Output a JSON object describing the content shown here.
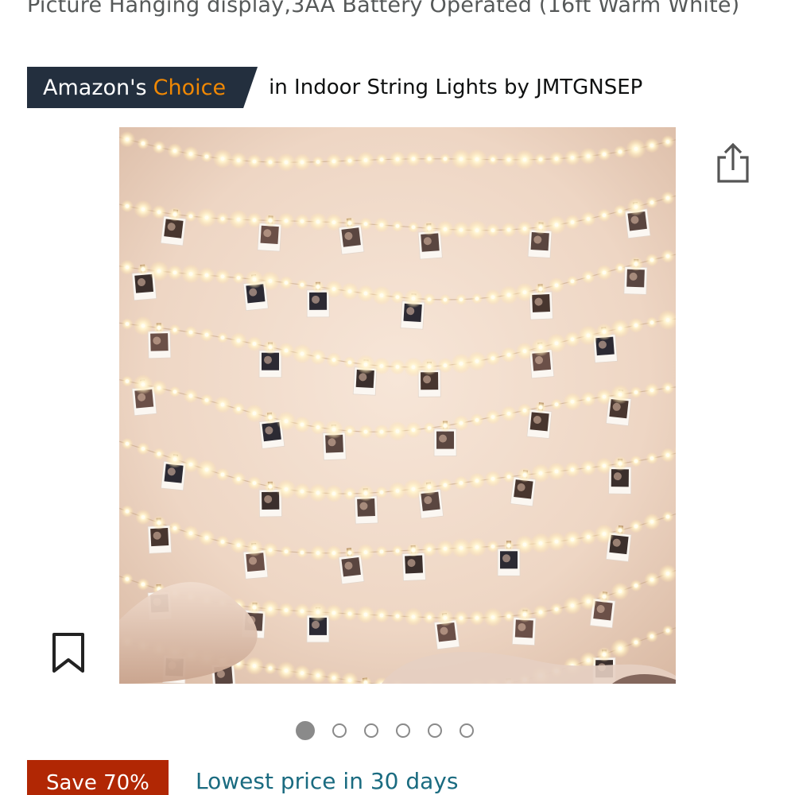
{
  "product": {
    "title": "Picture Hanging display,3AA Battery Operated (16ft Warm White)"
  },
  "badge": {
    "brand": "Amazon's",
    "choice": "Choice",
    "context": "in Indoor String Lights by JMTGNSEP"
  },
  "icons": {
    "share": "share-icon",
    "save": "bookmark-icon"
  },
  "carousel": {
    "total": 6,
    "active_index": 0
  },
  "deal": {
    "save_label": "Save 70%",
    "lowest_price_label": "Lowest price in 30 days"
  },
  "colors": {
    "badge_bg": "#232f3e",
    "choice_orange": "#f08804",
    "save_red": "#b12704",
    "link_teal": "#1a6b80"
  }
}
